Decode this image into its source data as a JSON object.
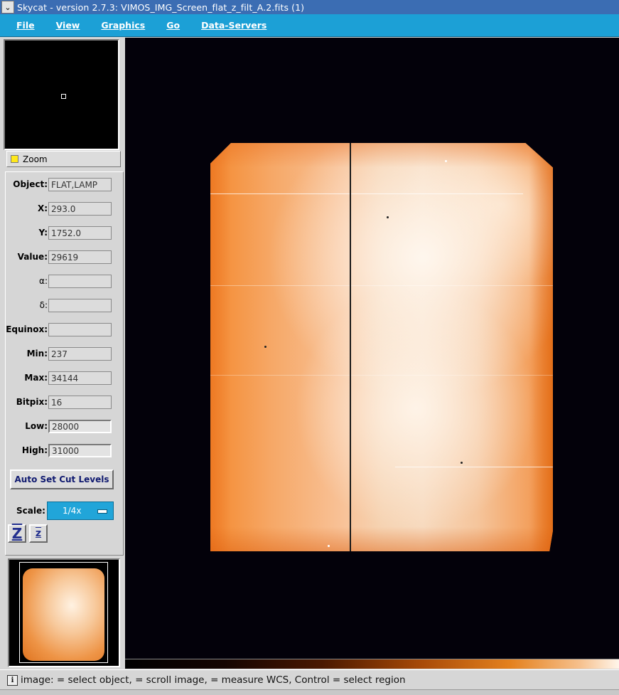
{
  "window": {
    "title": "Skycat - version 2.7.3: VIMOS_IMG_Screen_flat_z_filt_A.2.fits (1)",
    "menu_icon": "chevron-down-icon"
  },
  "menubar": {
    "items": [
      {
        "label": "File"
      },
      {
        "label": "View"
      },
      {
        "label": "Graphics"
      },
      {
        "label": "Go"
      },
      {
        "label": "Data-Servers"
      }
    ]
  },
  "zoom_label": "Zoom",
  "info": {
    "object": {
      "label": "Object:",
      "value": "FLAT,LAMP"
    },
    "x": {
      "label": "X:",
      "value": "293.0"
    },
    "y": {
      "label": "Y:",
      "value": "1752.0"
    },
    "value": {
      "label": "Value:",
      "value": "29619"
    },
    "alpha": {
      "label": "α:",
      "value": ""
    },
    "delta": {
      "label": "δ:",
      "value": ""
    },
    "equinox": {
      "label": "Equinox:",
      "value": ""
    },
    "min": {
      "label": "Min:",
      "value": "237"
    },
    "max": {
      "label": "Max:",
      "value": "34144"
    },
    "bitpix": {
      "label": "Bitpix:",
      "value": "16"
    },
    "low": {
      "label": "Low:",
      "value": "28000"
    },
    "high": {
      "label": "High:",
      "value": "31000"
    }
  },
  "auto_cut_label": "Auto Set Cut Levels",
  "scale": {
    "label": "Scale:",
    "value": "1/4x"
  },
  "zoom_buttons": {
    "in": "Z",
    "out": "z"
  },
  "status": {
    "text": "image:  = select object,  = scroll image,  = measure WCS, Control  = select region",
    "icon": "info-icon"
  },
  "colors": {
    "title_bar": "#3b6db3",
    "menu_bar": "#1ca0d6",
    "image_orange": "#f48a30",
    "background": "#03010a"
  }
}
